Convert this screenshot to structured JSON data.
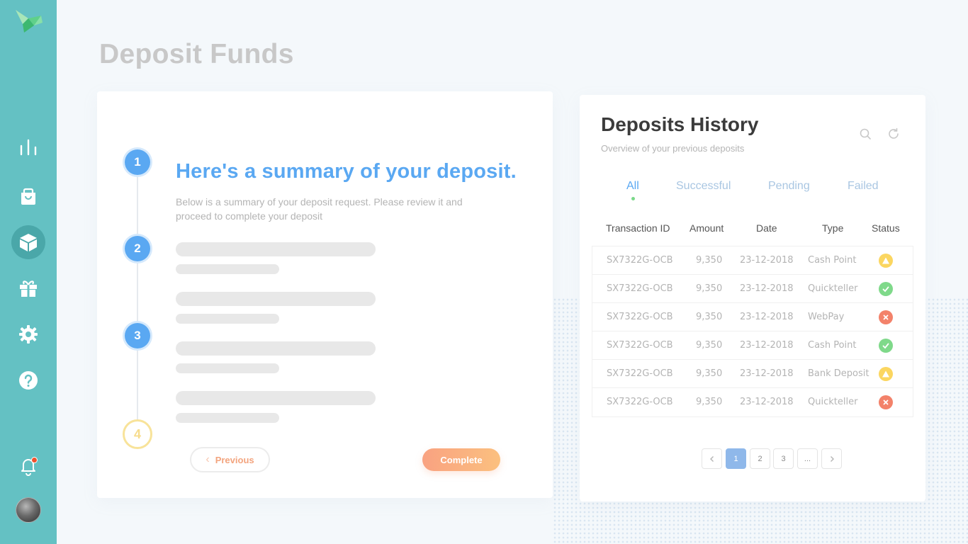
{
  "page": {
    "title": "Deposit Funds"
  },
  "sidebar": {
    "items": [
      {
        "name": "analytics",
        "icon": "bar-chart-icon"
      },
      {
        "name": "shop",
        "icon": "shopping-bag-icon"
      },
      {
        "name": "packages",
        "icon": "box-icon",
        "active": true
      },
      {
        "name": "rewards",
        "icon": "gift-icon"
      },
      {
        "name": "settings",
        "icon": "gear-icon"
      },
      {
        "name": "help",
        "icon": "help-icon"
      },
      {
        "name": "notifications",
        "icon": "bell-icon"
      }
    ],
    "accent_color": "#64c1c3"
  },
  "summary": {
    "steps": [
      "1",
      "2",
      "3",
      "4"
    ],
    "title": "Here's a summary of your deposit.",
    "description": "Below is a summary of your deposit request. Please review it and proceed to complete your deposit",
    "previous_label": "Previous",
    "complete_label": "Complete"
  },
  "history": {
    "title": "Deposits History",
    "subtitle": "Overview of your previous deposits",
    "tabs": [
      "All",
      "Successful",
      "Pending",
      "Failed"
    ],
    "active_tab": "All",
    "columns": [
      "Transaction ID",
      "Amount",
      "Date",
      "Type",
      "Status"
    ],
    "rows": [
      {
        "id": "SX7322G-OCB",
        "amount": "9,350",
        "date": "23-12-2018",
        "type": "Cash Point",
        "status": "pending"
      },
      {
        "id": "SX7322G-OCB",
        "amount": "9,350",
        "date": "23-12-2018",
        "type": "Quickteller",
        "status": "success"
      },
      {
        "id": "SX7322G-OCB",
        "amount": "9,350",
        "date": "23-12-2018",
        "type": "WebPay",
        "status": "failed"
      },
      {
        "id": "SX7322G-OCB",
        "amount": "9,350",
        "date": "23-12-2018",
        "type": "Cash Point",
        "status": "success"
      },
      {
        "id": "SX7322G-OCB",
        "amount": "9,350",
        "date": "23-12-2018",
        "type": "Bank Deposit",
        "status": "pending"
      },
      {
        "id": "SX7322G-OCB",
        "amount": "9,350",
        "date": "23-12-2018",
        "type": "Quickteller",
        "status": "failed"
      }
    ],
    "pagination": {
      "pages": [
        "1",
        "2",
        "3",
        "..."
      ],
      "current": "1"
    },
    "status_colors": {
      "pending": "#fbd660",
      "success": "#7fd98a",
      "failed": "#f3826a"
    }
  }
}
